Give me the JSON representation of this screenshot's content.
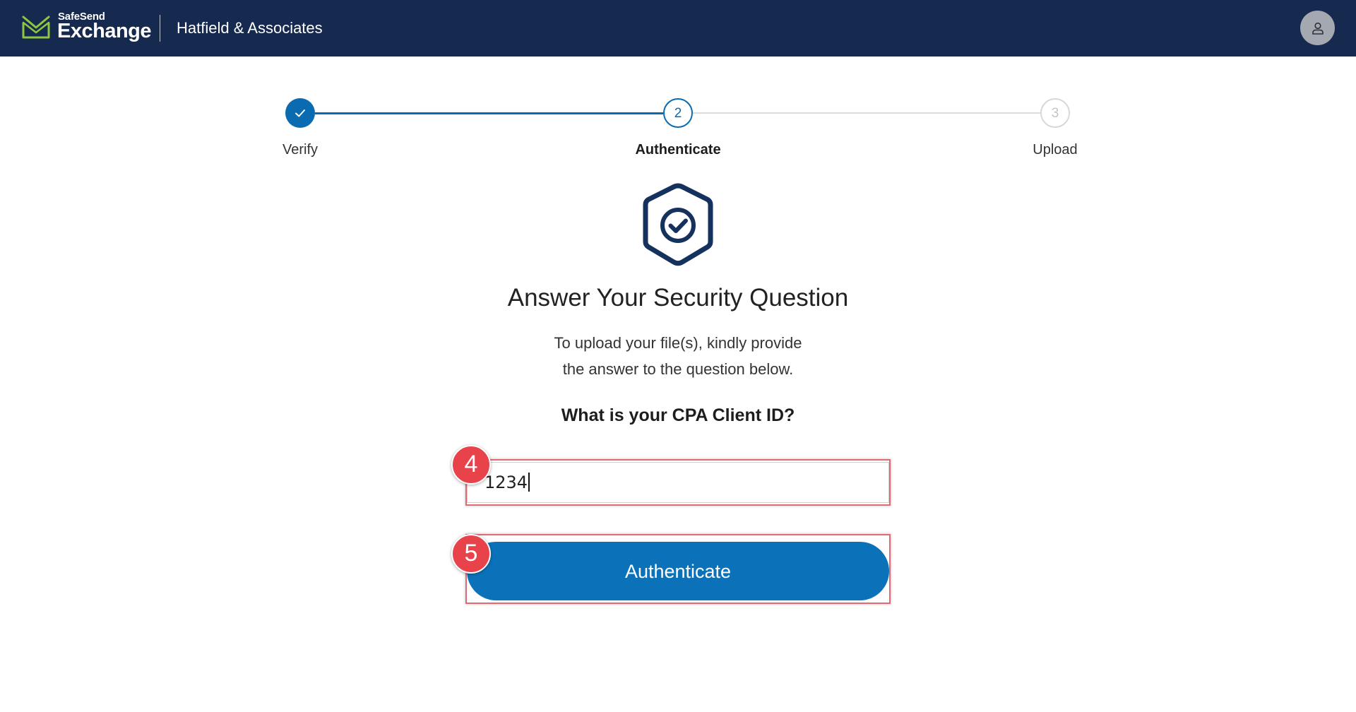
{
  "header": {
    "logo_icon": "envelope-check-icon",
    "brand_top": "SafeSend",
    "brand_main": "Exchange",
    "company": "Hatfield & Associates",
    "avatar_icon": "user-icon"
  },
  "stepper": {
    "steps": [
      {
        "label": "Verify",
        "state": "complete",
        "icon": "check-icon"
      },
      {
        "label": "Authenticate",
        "state": "active",
        "number": "2"
      },
      {
        "label": "Upload",
        "state": "pending",
        "number": "3"
      }
    ]
  },
  "main": {
    "icon": "shield-check-icon",
    "title": "Answer Your Security Question",
    "description_line1": "To upload your file(s), kindly provide",
    "description_line2": "the answer to the question below.",
    "question": "What is your CPA Client ID?",
    "answer_value": "1234",
    "submit_label": "Authenticate"
  },
  "annotations": {
    "input_badge": "4",
    "button_badge": "5"
  },
  "colors": {
    "header_bg": "#152a4e",
    "primary": "#0b72b9",
    "logo_green": "#8dc63f",
    "icon_navy": "#15325f",
    "annotation_red": "#e8424b"
  }
}
